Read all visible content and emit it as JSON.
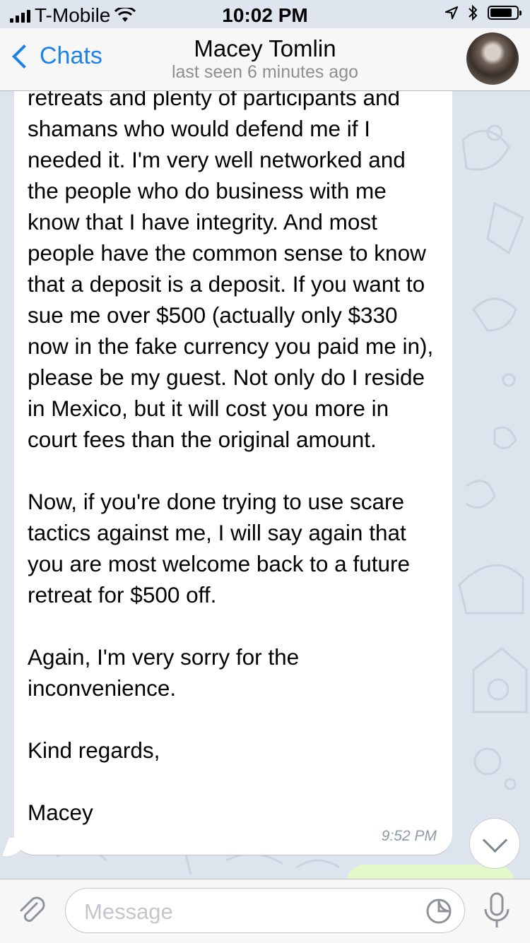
{
  "status_bar": {
    "carrier": "T-Mobile",
    "time": "10:02 PM",
    "icons": [
      "signal-icon",
      "wifi-icon",
      "location-icon",
      "bluetooth-icon",
      "battery-icon"
    ]
  },
  "header": {
    "back_label": "Chats",
    "title": "Macey Tomlin",
    "subtitle": "last seen 6 minutes ago"
  },
  "message": {
    "text": "retreats and plenty of participants and\nshamans who would defend me if I needed it. I'm very well networked and the people who do business with me know that I have integrity. And most people have the common sense to know that a deposit is a deposit. If you want to sue me over $500 (actually only $330 now in the fake currency you paid me in), please be my guest. Not only do I reside in Mexico, but it will cost you more in court fees than the original amount.\n\nNow, if you're done trying to use scare tactics against me, I will say again that you are most welcome back to a future retreat for $500 off.\n\nAgain, I'm very sorry for the inconvenience.\n\nKind regards,\n\nMacey",
    "time": "9:52 PM"
  },
  "composer": {
    "placeholder": "Message"
  },
  "colors": {
    "accent": "#1d83ea",
    "chat_background": "#dde4ee",
    "incoming_bubble": "#ffffff",
    "outgoing_bubble": "#e2f8c8"
  }
}
